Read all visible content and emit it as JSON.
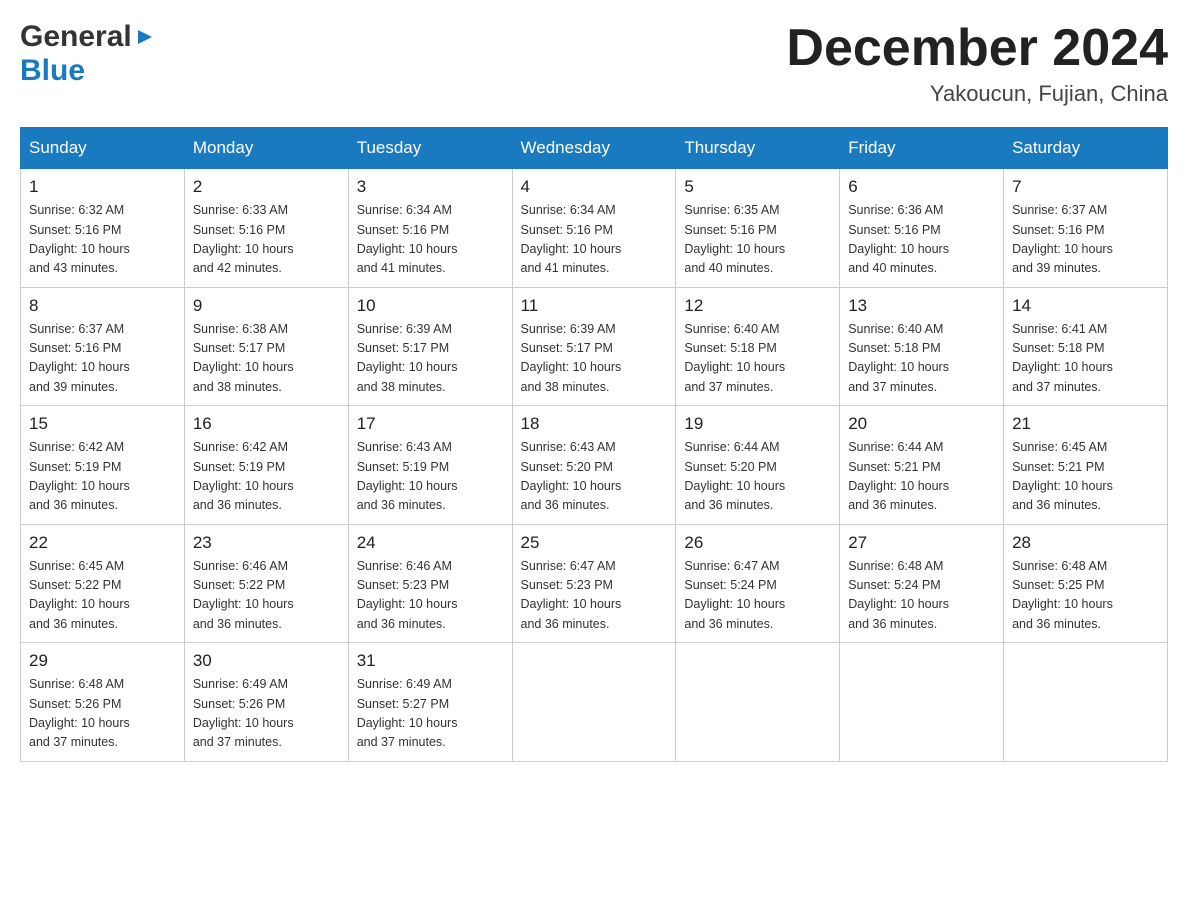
{
  "header": {
    "logo_general": "General",
    "logo_blue": "Blue",
    "month_title": "December 2024",
    "location": "Yakoucun, Fujian, China"
  },
  "days_of_week": [
    "Sunday",
    "Monday",
    "Tuesday",
    "Wednesday",
    "Thursday",
    "Friday",
    "Saturday"
  ],
  "weeks": [
    [
      {
        "num": "1",
        "sunrise": "6:32 AM",
        "sunset": "5:16 PM",
        "daylight": "10 hours and 43 minutes."
      },
      {
        "num": "2",
        "sunrise": "6:33 AM",
        "sunset": "5:16 PM",
        "daylight": "10 hours and 42 minutes."
      },
      {
        "num": "3",
        "sunrise": "6:34 AM",
        "sunset": "5:16 PM",
        "daylight": "10 hours and 41 minutes."
      },
      {
        "num": "4",
        "sunrise": "6:34 AM",
        "sunset": "5:16 PM",
        "daylight": "10 hours and 41 minutes."
      },
      {
        "num": "5",
        "sunrise": "6:35 AM",
        "sunset": "5:16 PM",
        "daylight": "10 hours and 40 minutes."
      },
      {
        "num": "6",
        "sunrise": "6:36 AM",
        "sunset": "5:16 PM",
        "daylight": "10 hours and 40 minutes."
      },
      {
        "num": "7",
        "sunrise": "6:37 AM",
        "sunset": "5:16 PM",
        "daylight": "10 hours and 39 minutes."
      }
    ],
    [
      {
        "num": "8",
        "sunrise": "6:37 AM",
        "sunset": "5:16 PM",
        "daylight": "10 hours and 39 minutes."
      },
      {
        "num": "9",
        "sunrise": "6:38 AM",
        "sunset": "5:17 PM",
        "daylight": "10 hours and 38 minutes."
      },
      {
        "num": "10",
        "sunrise": "6:39 AM",
        "sunset": "5:17 PM",
        "daylight": "10 hours and 38 minutes."
      },
      {
        "num": "11",
        "sunrise": "6:39 AM",
        "sunset": "5:17 PM",
        "daylight": "10 hours and 38 minutes."
      },
      {
        "num": "12",
        "sunrise": "6:40 AM",
        "sunset": "5:18 PM",
        "daylight": "10 hours and 37 minutes."
      },
      {
        "num": "13",
        "sunrise": "6:40 AM",
        "sunset": "5:18 PM",
        "daylight": "10 hours and 37 minutes."
      },
      {
        "num": "14",
        "sunrise": "6:41 AM",
        "sunset": "5:18 PM",
        "daylight": "10 hours and 37 minutes."
      }
    ],
    [
      {
        "num": "15",
        "sunrise": "6:42 AM",
        "sunset": "5:19 PM",
        "daylight": "10 hours and 36 minutes."
      },
      {
        "num": "16",
        "sunrise": "6:42 AM",
        "sunset": "5:19 PM",
        "daylight": "10 hours and 36 minutes."
      },
      {
        "num": "17",
        "sunrise": "6:43 AM",
        "sunset": "5:19 PM",
        "daylight": "10 hours and 36 minutes."
      },
      {
        "num": "18",
        "sunrise": "6:43 AM",
        "sunset": "5:20 PM",
        "daylight": "10 hours and 36 minutes."
      },
      {
        "num": "19",
        "sunrise": "6:44 AM",
        "sunset": "5:20 PM",
        "daylight": "10 hours and 36 minutes."
      },
      {
        "num": "20",
        "sunrise": "6:44 AM",
        "sunset": "5:21 PM",
        "daylight": "10 hours and 36 minutes."
      },
      {
        "num": "21",
        "sunrise": "6:45 AM",
        "sunset": "5:21 PM",
        "daylight": "10 hours and 36 minutes."
      }
    ],
    [
      {
        "num": "22",
        "sunrise": "6:45 AM",
        "sunset": "5:22 PM",
        "daylight": "10 hours and 36 minutes."
      },
      {
        "num": "23",
        "sunrise": "6:46 AM",
        "sunset": "5:22 PM",
        "daylight": "10 hours and 36 minutes."
      },
      {
        "num": "24",
        "sunrise": "6:46 AM",
        "sunset": "5:23 PM",
        "daylight": "10 hours and 36 minutes."
      },
      {
        "num": "25",
        "sunrise": "6:47 AM",
        "sunset": "5:23 PM",
        "daylight": "10 hours and 36 minutes."
      },
      {
        "num": "26",
        "sunrise": "6:47 AM",
        "sunset": "5:24 PM",
        "daylight": "10 hours and 36 minutes."
      },
      {
        "num": "27",
        "sunrise": "6:48 AM",
        "sunset": "5:24 PM",
        "daylight": "10 hours and 36 minutes."
      },
      {
        "num": "28",
        "sunrise": "6:48 AM",
        "sunset": "5:25 PM",
        "daylight": "10 hours and 36 minutes."
      }
    ],
    [
      {
        "num": "29",
        "sunrise": "6:48 AM",
        "sunset": "5:26 PM",
        "daylight": "10 hours and 37 minutes."
      },
      {
        "num": "30",
        "sunrise": "6:49 AM",
        "sunset": "5:26 PM",
        "daylight": "10 hours and 37 minutes."
      },
      {
        "num": "31",
        "sunrise": "6:49 AM",
        "sunset": "5:27 PM",
        "daylight": "10 hours and 37 minutes."
      },
      null,
      null,
      null,
      null
    ]
  ],
  "labels": {
    "sunrise_prefix": "Sunrise: ",
    "sunset_prefix": "Sunset: ",
    "daylight_prefix": "Daylight: "
  }
}
